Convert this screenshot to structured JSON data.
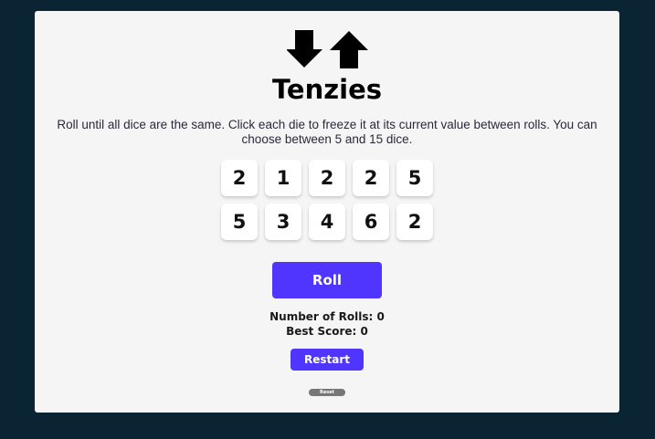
{
  "game": {
    "title": "Tenzies",
    "instructions": "Roll until all dice are the same. Click each die to freeze it at its current value between rolls. You can choose between 5 and 15 dice.",
    "icons": [
      "arrow-down-icon",
      "arrow-up-icon"
    ],
    "dice": [
      2,
      1,
      2,
      2,
      5,
      5,
      3,
      4,
      6,
      2
    ],
    "roll_label": "Roll",
    "stats": {
      "rolls_label": "Number of Rolls:",
      "rolls_value": "0",
      "best_label": "Best Score:",
      "best_value": "0"
    },
    "restart_label": "Restart",
    "reset_label": "Reset"
  },
  "colors": {
    "background": "#0b2434",
    "card": "#f5f5f5",
    "accent": "#5035ff",
    "die": "#ffffff",
    "reset": "#777777"
  }
}
